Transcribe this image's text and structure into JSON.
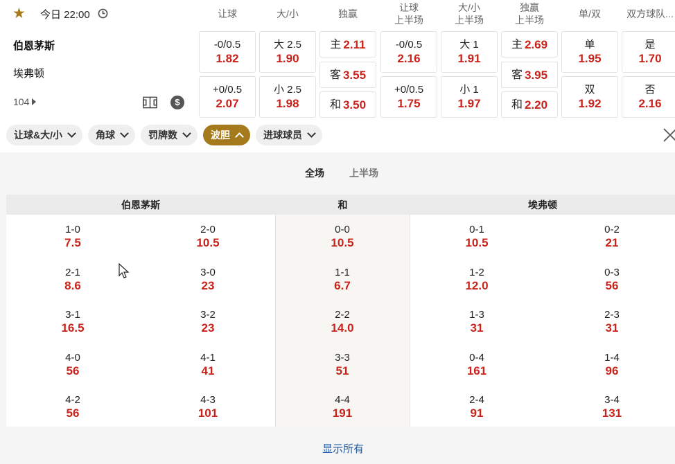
{
  "header": {
    "time": "今日 22:00",
    "home_team": "伯恩茅斯",
    "away_team": "埃弗顿",
    "more_markets": "104"
  },
  "columns": [
    {
      "id": "handicap",
      "l1": "让球",
      "l2": ""
    },
    {
      "id": "ou",
      "l1": "大/小",
      "l2": ""
    },
    {
      "id": "1x2",
      "l1": "独赢",
      "l2": ""
    },
    {
      "id": "ht_handicap",
      "l1": "让球",
      "l2": "上半场"
    },
    {
      "id": "ht_ou",
      "l1": "大/小",
      "l2": "上半场"
    },
    {
      "id": "ht_1x2",
      "l1": "独赢",
      "l2": "上半场"
    },
    {
      "id": "oe",
      "l1": "单/双",
      "l2": ""
    },
    {
      "id": "btts",
      "l1": "双方球队...",
      "l2": ""
    }
  ],
  "odds": {
    "handicap": [
      {
        "line": "-0/0.5",
        "price": "1.82"
      },
      {
        "line": "+0/0.5",
        "price": "2.07"
      }
    ],
    "ou": [
      {
        "line": "大 2.5",
        "price": "1.90"
      },
      {
        "line": "小 2.5",
        "price": "1.98"
      }
    ],
    "1x2": [
      {
        "line": "主",
        "price": "2.11"
      },
      {
        "line": "客",
        "price": "3.55"
      },
      {
        "line": "和",
        "price": "3.50"
      }
    ],
    "ht_handicap": [
      {
        "line": "-0/0.5",
        "price": "2.16"
      },
      {
        "line": "+0/0.5",
        "price": "1.75"
      }
    ],
    "ht_ou": [
      {
        "line": "大 1",
        "price": "1.91"
      },
      {
        "line": "小 1",
        "price": "1.97"
      }
    ],
    "ht_1x2": [
      {
        "line": "主",
        "price": "2.69"
      },
      {
        "line": "客",
        "price": "3.95"
      },
      {
        "line": "和",
        "price": "2.20"
      }
    ],
    "oe": [
      {
        "line": "单",
        "price": "1.95"
      },
      {
        "line": "双",
        "price": "1.92"
      }
    ],
    "btts": [
      {
        "line": "是",
        "price": "1.70"
      },
      {
        "line": "否",
        "price": "2.16"
      }
    ]
  },
  "filters": [
    {
      "label": "让球&大/小",
      "active": false
    },
    {
      "label": "角球",
      "active": false
    },
    {
      "label": "罚牌数",
      "active": false
    },
    {
      "label": "波胆",
      "active": true
    },
    {
      "label": "进球球员",
      "active": false
    }
  ],
  "period_tabs": [
    {
      "label": "全场",
      "active": true
    },
    {
      "label": "上半场",
      "active": false
    }
  ],
  "correct_score": {
    "headers": {
      "home": "伯恩茅斯",
      "draw": "和",
      "away": "埃弗顿"
    },
    "rows": [
      [
        {
          "s": "1-0",
          "p": "7.5"
        },
        {
          "s": "2-0",
          "p": "10.5"
        },
        {
          "s": "0-0",
          "p": "10.5"
        },
        {
          "s": "0-1",
          "p": "10.5"
        },
        {
          "s": "0-2",
          "p": "21"
        }
      ],
      [
        {
          "s": "2-1",
          "p": "8.6"
        },
        {
          "s": "3-0",
          "p": "23"
        },
        {
          "s": "1-1",
          "p": "6.7"
        },
        {
          "s": "1-2",
          "p": "12.0"
        },
        {
          "s": "0-3",
          "p": "56"
        }
      ],
      [
        {
          "s": "3-1",
          "p": "16.5"
        },
        {
          "s": "3-2",
          "p": "23"
        },
        {
          "s": "2-2",
          "p": "14.0"
        },
        {
          "s": "1-3",
          "p": "31"
        },
        {
          "s": "2-3",
          "p": "31"
        }
      ],
      [
        {
          "s": "4-0",
          "p": "56"
        },
        {
          "s": "4-1",
          "p": "41"
        },
        {
          "s": "3-3",
          "p": "51"
        },
        {
          "s": "0-4",
          "p": "161"
        },
        {
          "s": "1-4",
          "p": "96"
        }
      ],
      [
        {
          "s": "4-2",
          "p": "56"
        },
        {
          "s": "4-3",
          "p": "101"
        },
        {
          "s": "4-4",
          "p": "191"
        },
        {
          "s": "2-4",
          "p": "91"
        },
        {
          "s": "3-4",
          "p": "131"
        }
      ]
    ]
  },
  "show_all": "显示所有",
  "colors": {
    "accent": "#a57a1d",
    "price": "#c8221b",
    "link": "#1c5aa6"
  }
}
